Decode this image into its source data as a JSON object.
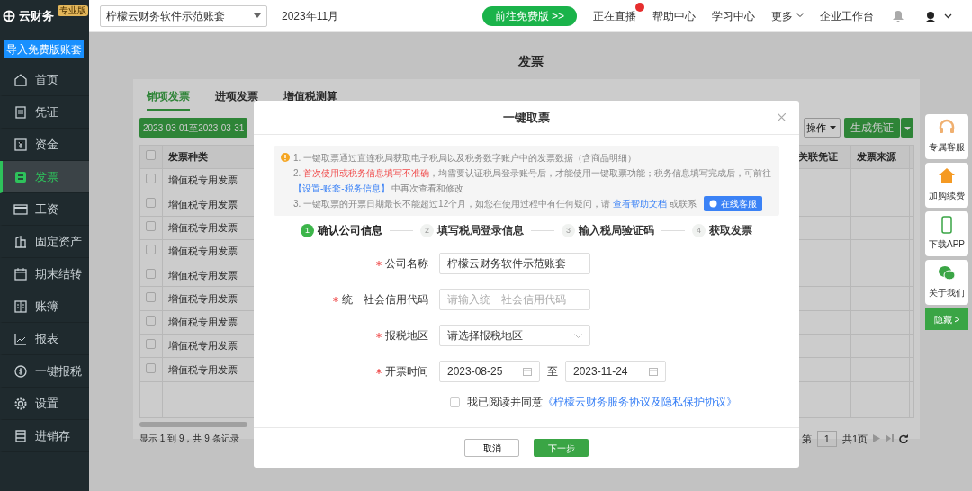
{
  "top_bar": {
    "logo": "云财务",
    "edition": "专业版",
    "account_select": "柠檬云财务软件示范账套",
    "period": "2023年11月",
    "promo_button": "前往免费版 >>",
    "links": [
      {
        "label": "正在直播",
        "hot": true
      },
      {
        "label": "帮助中心"
      },
      {
        "label": "学习中心"
      },
      {
        "label": "更多",
        "dropdown": true
      },
      {
        "label": "企业工作台"
      }
    ]
  },
  "sidebar": {
    "import_button": "导入免费版账套",
    "items": [
      {
        "label": "首页",
        "selected": false
      },
      {
        "label": "凭证",
        "selected": false
      },
      {
        "label": "资金",
        "selected": false
      },
      {
        "label": "发票",
        "selected": true
      },
      {
        "label": "工资",
        "selected": false
      },
      {
        "label": "固定资产",
        "selected": false
      },
      {
        "label": "期末结转",
        "selected": false
      },
      {
        "label": "账簿",
        "selected": false
      },
      {
        "label": "报表",
        "selected": false
      },
      {
        "label": "一键报税",
        "selected": false
      },
      {
        "label": "设置",
        "selected": false
      },
      {
        "label": "进销存",
        "selected": false
      }
    ]
  },
  "page": {
    "title": "发票",
    "tabs": [
      {
        "label": "销项发票",
        "selected": true
      },
      {
        "label": "进项发票",
        "selected": false
      },
      {
        "label": "增值税测算",
        "selected": false
      }
    ],
    "date_range": "2023-03-01至2023-03-31",
    "batch_button": "操作",
    "voucher_button": "生成凭证",
    "table": {
      "select_all_checked": false,
      "left_columns": [
        "发票种类"
      ],
      "right_columns": [
        "关联凭证",
        "发票来源"
      ],
      "rows": [
        {
          "checked": false,
          "type": "增值税专用发票"
        },
        {
          "checked": false,
          "type": "增值税专用发票"
        },
        {
          "checked": false,
          "type": "增值税专用发票"
        },
        {
          "checked": false,
          "type": "增值税专用发票"
        },
        {
          "checked": false,
          "type": "增值税专用发票"
        },
        {
          "checked": false,
          "type": "增值税专用发票"
        },
        {
          "checked": false,
          "type": "增值税专用发票"
        },
        {
          "checked": false,
          "type": "增值税专用发票"
        },
        {
          "checked": false,
          "type": "增值税专用发票"
        }
      ]
    },
    "record_count": "显示 1 到 9，共 9 条记录",
    "pager": {
      "prefix": "第",
      "page": "1",
      "total": "共1页"
    }
  },
  "modal": {
    "title": "一键取票",
    "notice": [
      [
        {
          "kind": "plain",
          "text": "1. 一键取票通过直连税局获取电子税局以及税务数字账户中的发票数据（含商品明细）"
        }
      ],
      [
        {
          "kind": "plain",
          "text": "2. "
        },
        {
          "kind": "warn",
          "text": "首次使用或税务信息填写不准确"
        },
        {
          "kind": "plain",
          "text": "，均需要认证税局登录账号后，才能使用一键取票功能；税务信息填写完成后，可前往 "
        },
        {
          "kind": "link",
          "text": "【设置-账套-税务信息】"
        },
        {
          "kind": "plain",
          "text": " 中再次查看和修改"
        }
      ],
      [
        {
          "kind": "plain",
          "text": "3. 一键取票的开票日期最长不能超过12个月，如您在使用过程中有任何疑问，请 "
        },
        {
          "kind": "link",
          "text": "查看帮助文档"
        },
        {
          "kind": "plain",
          "text": " 或联系"
        }
      ]
    ],
    "service_button": "在线客服",
    "steps": [
      {
        "number": "1",
        "label": "确认公司信息",
        "selected": true
      },
      {
        "number": "2",
        "label": "填写税局登录信息",
        "selected": false
      },
      {
        "number": "3",
        "label": "输入税局验证码",
        "selected": false
      },
      {
        "number": "4",
        "label": "获取发票",
        "selected": false
      }
    ],
    "fields": [
      {
        "kind": "text",
        "label": "公司名称",
        "required": true,
        "value": "柠檬云财务软件示范账套"
      },
      {
        "kind": "text",
        "label": "统一社会信用代码",
        "required": true,
        "placeholder": "请输入统一社会信用代码"
      },
      {
        "kind": "select",
        "label": "报税地区",
        "required": true,
        "placeholder": "请选择报税地区"
      },
      {
        "kind": "daterange",
        "label": "开票时间",
        "required": true,
        "start": "2023-08-25",
        "separator": "至",
        "end": "2023-11-24"
      }
    ],
    "agreement": {
      "checked": false,
      "text": "我已阅读并同意",
      "link": "《柠檬云财务服务协议及隐私保护协议》"
    },
    "cancel_button": "取消",
    "next_button": "下一步"
  },
  "side_widgets": [
    {
      "label": "专属客服"
    },
    {
      "label": "加购续费"
    },
    {
      "label": "下载APP"
    },
    {
      "label": "关于我们"
    }
  ],
  "hide_button": "隐藏 >"
}
